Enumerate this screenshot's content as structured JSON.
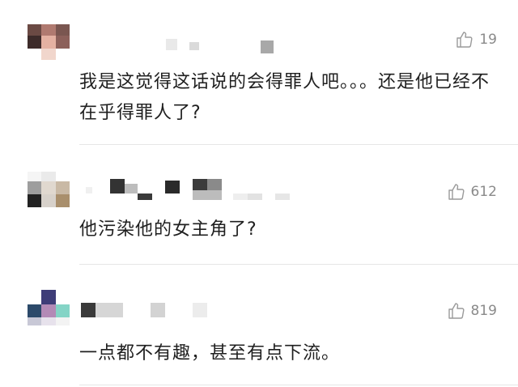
{
  "comments": [
    {
      "likes": "19",
      "text": "我是这觉得这话说的会得罪人吧。。。还是他已经不在乎得罪人了?"
    },
    {
      "likes": "612",
      "text": "他污染他的女主角了?"
    },
    {
      "likes": "819",
      "text": "一点都不有趣，甚至有点下流。"
    }
  ],
  "icons": {
    "like": "thumbs-up-outline-icon"
  },
  "colors": {
    "text": "#1f1f1f",
    "meta": "#8a8a8a",
    "divider": "#e6e6e6"
  }
}
